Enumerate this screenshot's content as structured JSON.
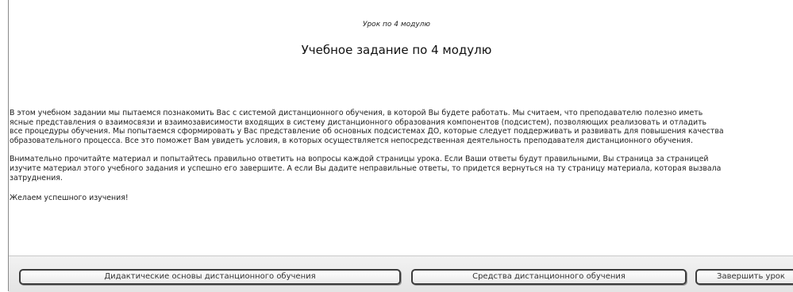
{
  "header": {
    "breadcrumb": "Урок по 4 модулю",
    "title": "Учебное задание по 4 модулю"
  },
  "content": {
    "paragraph1": [
      "В этом учебном задании мы пытаемся познакомить Вас с системой дистанционного обучения, в которой Вы будете работать. Мы считаем, что преподавателю полезно иметь",
      "ясные представления о взаимосвязи и взаимозависимости входящих в систему дистанционного образования компонентов (подсистем), позволяющих реализовать и отладить",
      "все процедуры обучения. Мы попытаемся сформировать у Вас представление об основных подсистемах ДО, которые следует поддерживать и развивать для повышения качества",
      "образовательного процесса. Все это поможет Вам увидеть условия, в которых осуществляется непосредственная деятельность преподавателя дистанционного обучения."
    ],
    "paragraph2": [
      "Внимательно прочитайте материал и попытайтесь правильно ответить на вопросы каждой страницы урока. Если Ваши ответы будут правильными, Вы страница за страницей",
      "изучите материал этого учебного задания и успешно его завершите. А если Вы дадите неправильные ответы, то придется вернуться на ту страницу материала, которая вызвала",
      "затруднения."
    ],
    "closing": "Желаем успешного изучения!"
  },
  "nav": {
    "btn_prev": "Дидактические основы дистанционного обучения",
    "btn_next": "Средства дистанционного обучения",
    "btn_finish": "Завершить урок"
  }
}
